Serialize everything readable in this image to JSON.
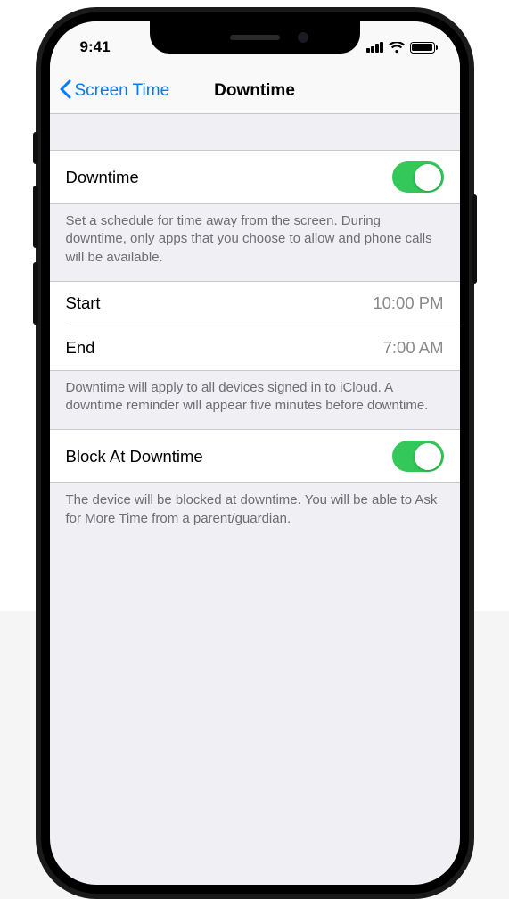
{
  "status": {
    "time": "9:41"
  },
  "nav": {
    "back_label": "Screen Time",
    "title": "Downtime"
  },
  "downtime_toggle": {
    "label": "Downtime",
    "on": true,
    "footer": "Set a schedule for time away from the screen. During downtime, only apps that you choose to allow and phone calls will be available."
  },
  "schedule": {
    "start_label": "Start",
    "start_value": "10:00 PM",
    "end_label": "End",
    "end_value": "7:00 AM",
    "footer": "Downtime will apply to all devices signed in to iCloud. A downtime reminder will appear five minutes before downtime."
  },
  "block": {
    "label": "Block At Downtime",
    "on": true,
    "footer": "The device will be blocked at downtime. You will be able to Ask for More Time from a parent/guardian."
  },
  "colors": {
    "accent": "#007aff",
    "toggle_on": "#34c759",
    "bg": "#efeff4",
    "separator": "#c7c7cc",
    "secondary_text": "#6d6d72",
    "value_text": "#8a8a8e"
  }
}
